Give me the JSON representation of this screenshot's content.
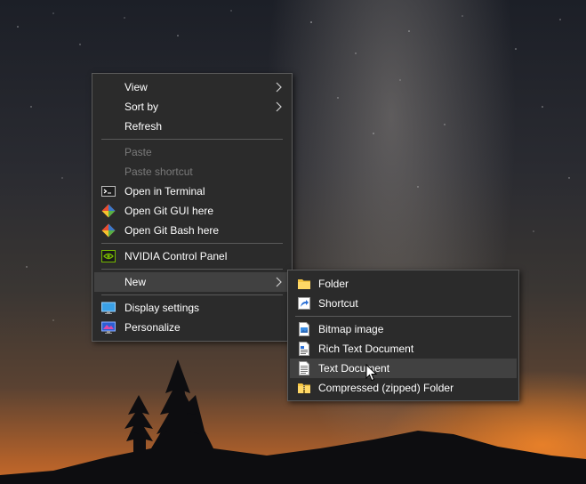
{
  "context_menu": {
    "items": [
      {
        "label": "View",
        "has_submenu": true
      },
      {
        "label": "Sort by",
        "has_submenu": true
      },
      {
        "label": "Refresh"
      },
      {
        "label": "Paste",
        "disabled": true
      },
      {
        "label": "Paste shortcut",
        "disabled": true
      },
      {
        "label": "Open in Terminal",
        "icon": "terminal-icon"
      },
      {
        "label": "Open Git GUI here",
        "icon": "git-gui-icon"
      },
      {
        "label": "Open Git Bash here",
        "icon": "git-bash-icon"
      },
      {
        "label": "NVIDIA Control Panel",
        "icon": "nvidia-icon"
      },
      {
        "label": "New",
        "has_submenu": true,
        "highlighted": true
      },
      {
        "label": "Display settings",
        "icon": "display-settings-icon"
      },
      {
        "label": "Personalize",
        "icon": "personalize-icon"
      }
    ]
  },
  "new_submenu": {
    "items": [
      {
        "label": "Folder",
        "icon": "folder-icon"
      },
      {
        "label": "Shortcut",
        "icon": "shortcut-icon"
      },
      {
        "label": "Bitmap image",
        "icon": "bitmap-image-icon"
      },
      {
        "label": "Rich Text Document",
        "icon": "rich-text-document-icon"
      },
      {
        "label": "Text Document",
        "icon": "text-document-icon",
        "highlighted": true
      },
      {
        "label": "Compressed (zipped) Folder",
        "icon": "zipped-folder-icon"
      }
    ]
  },
  "colors": {
    "menu_bg": "#2b2b2b",
    "menu_border": "#5a5a5a",
    "highlight": "#414141",
    "disabled_text": "#7a7a7a"
  }
}
